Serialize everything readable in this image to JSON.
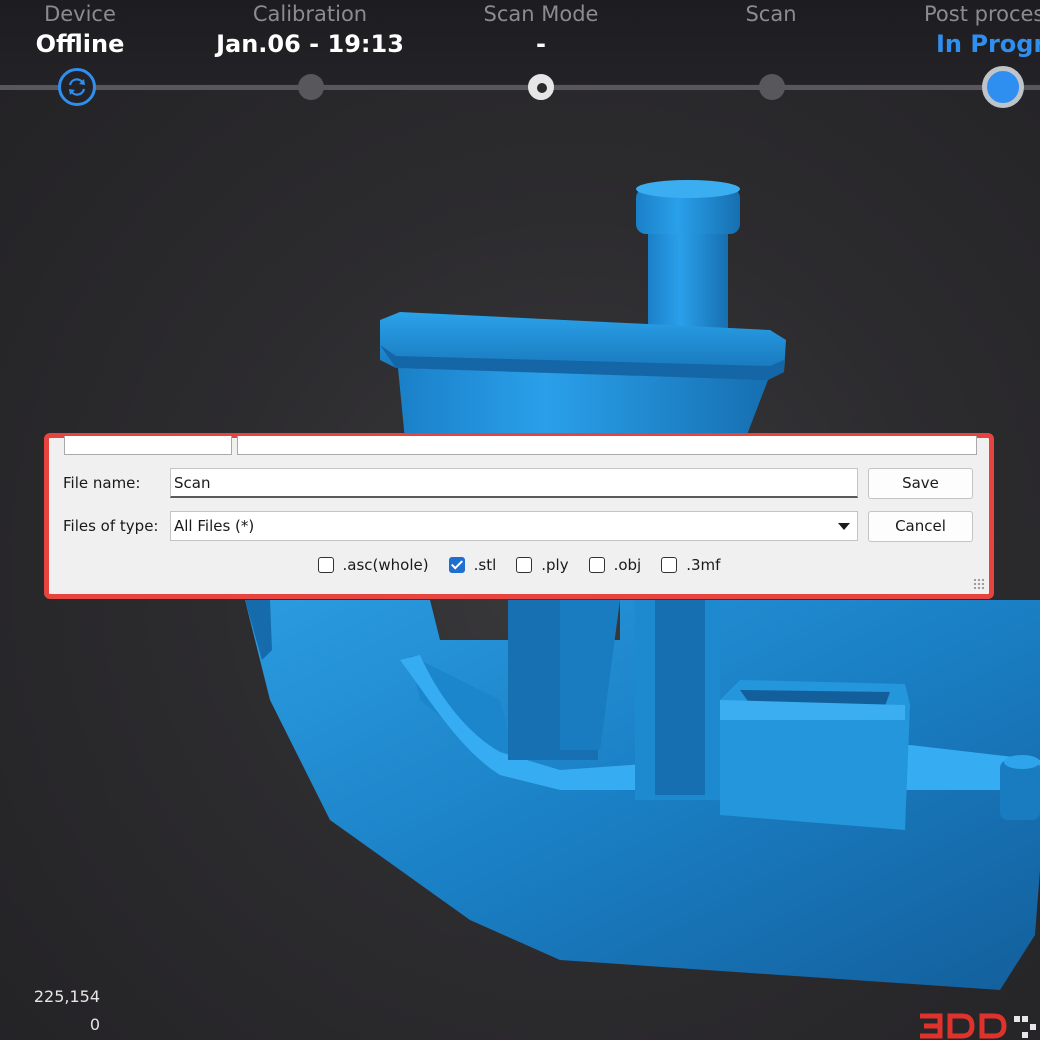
{
  "steps": [
    {
      "label": "Device",
      "value": "Offline"
    },
    {
      "label": "Calibration",
      "value": "Jan.06 - 19:13"
    },
    {
      "label": "Scan Mode",
      "value": "-"
    },
    {
      "label": "Scan",
      "value": ""
    },
    {
      "label": "Post proces",
      "value": "In Progre"
    }
  ],
  "dialog": {
    "file_name_label": "File name:",
    "file_name_value": "Scan",
    "file_type_label": "Files of type:",
    "file_type_value": "All Files (*)",
    "save_label": "Save",
    "cancel_label": "Cancel",
    "formats": [
      {
        "label": ".asc(whole)",
        "checked": false
      },
      {
        "label": ".stl",
        "checked": true
      },
      {
        "label": ".ply",
        "checked": false
      },
      {
        "label": ".obj",
        "checked": false
      },
      {
        "label": ".3mf",
        "checked": false
      }
    ]
  },
  "stats": {
    "points": "225,154",
    "second": "0"
  },
  "colors": {
    "accent": "#2f8ff0",
    "model": "#1f86c8",
    "highlight": "#e8443f"
  },
  "icons": {
    "device": "sync-icon",
    "checkbox": "checkbox-icon",
    "dropdown": "dropdown-arrow-icon"
  }
}
